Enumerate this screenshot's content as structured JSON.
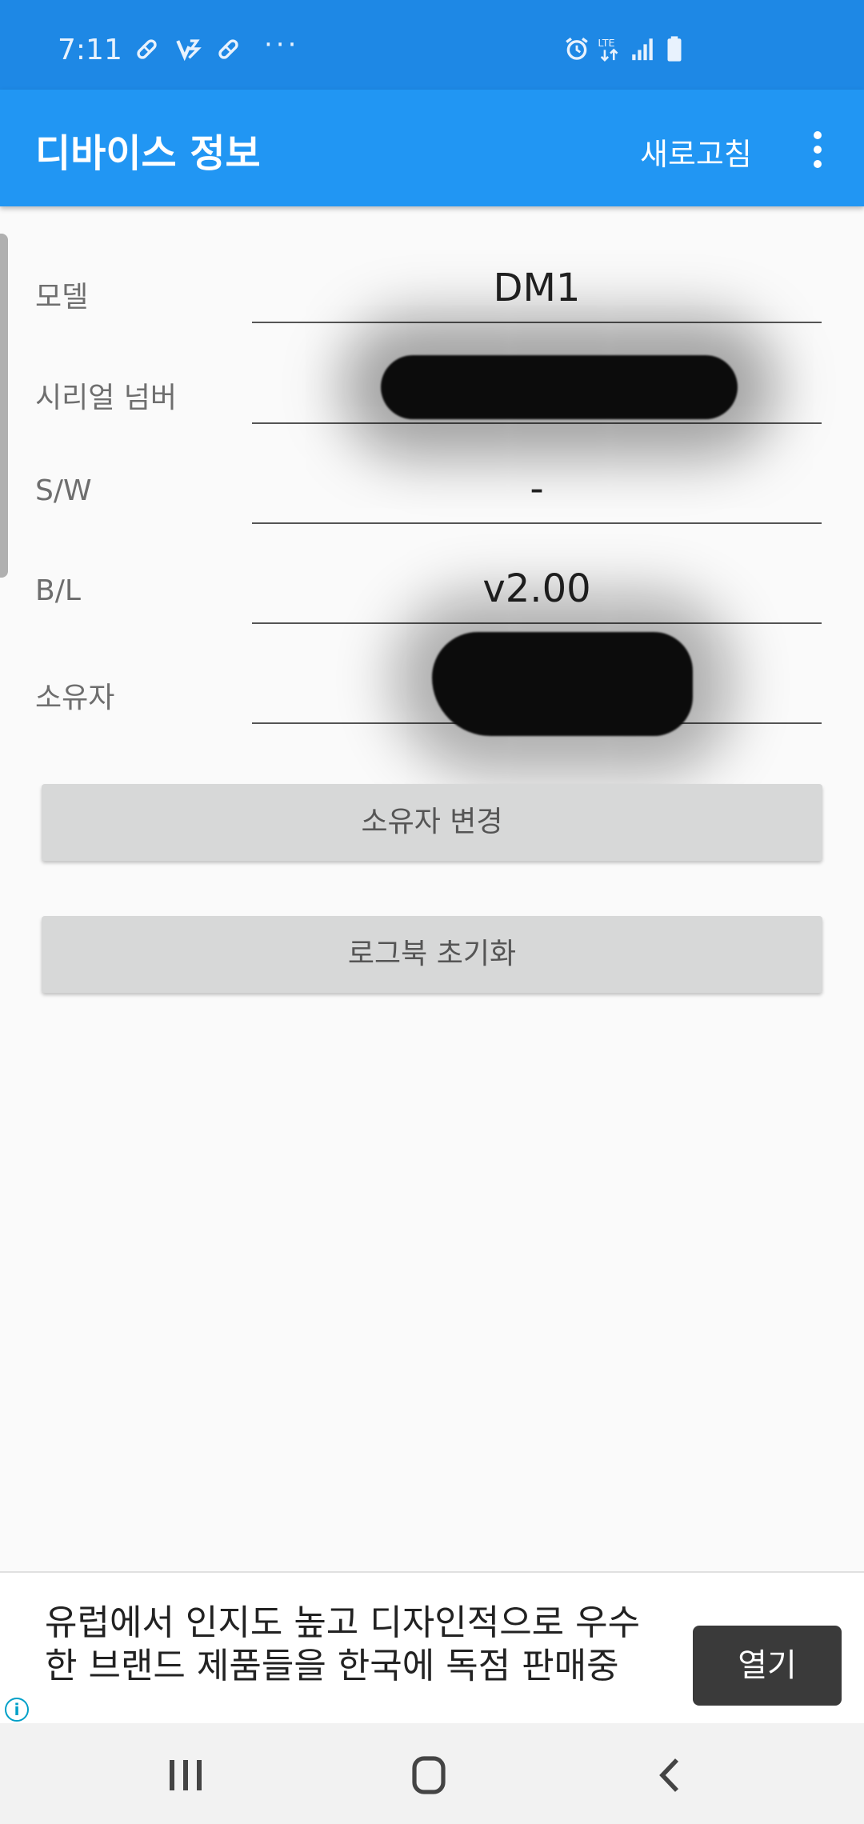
{
  "status_bar": {
    "time": "7:11",
    "left_icons": [
      "pill-icon",
      "v-notification-icon",
      "pill-icon"
    ],
    "more": "···",
    "right_icons": [
      "alarm-icon",
      "lte-icon",
      "signal-icon",
      "battery-icon"
    ]
  },
  "app_bar": {
    "title": "디바이스 정보",
    "refresh_label": "새로고침",
    "overflow_icon": "more-vert-icon"
  },
  "fields": [
    {
      "label": "모델",
      "value": "DM1"
    },
    {
      "label": "시리얼 넘버",
      "value": ""
    },
    {
      "label": "S/W",
      "value": "-"
    },
    {
      "label": "B/L",
      "value": "v2.00"
    },
    {
      "label": "소유자",
      "value": ""
    }
  ],
  "buttons": {
    "change_owner": "소유자 변경",
    "reset_logbook": "로그북 초기화"
  },
  "ad": {
    "text": "유럽에서 인지도 높고 디자인적으로 우수한 브랜드 제품들을 한국에 독점 판매중",
    "info_glyph": "i",
    "open_label": "열기"
  },
  "nav_bar": {
    "icons": [
      "recent-apps-icon",
      "home-icon",
      "back-icon"
    ]
  },
  "colors": {
    "status_bar": "#1e88e5",
    "app_bar": "#2196f3",
    "background": "#fafafa",
    "button": "#d7d8d8"
  }
}
